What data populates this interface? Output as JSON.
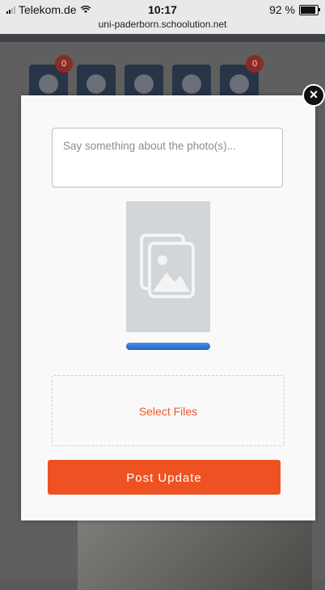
{
  "status_bar": {
    "carrier": "Telekom.de",
    "time": "10:17",
    "battery_percent": "92 %",
    "battery_level": 0.92,
    "url": "uni-paderborn.schoolution.net"
  },
  "background": {
    "tiles": [
      {
        "icon": "clipboard-icon",
        "badge": "0"
      },
      {
        "icon": "map-pin-icon",
        "badge": ""
      },
      {
        "icon": "runner-icon",
        "badge": ""
      },
      {
        "icon": "smiley-icon",
        "badge": ""
      },
      {
        "icon": "share-icon",
        "badge": "0"
      }
    ]
  },
  "modal": {
    "close_icon": "close-icon",
    "caption_placeholder": "Say something about the photo(s)...",
    "preview_icon": "images-icon",
    "upload_progress": 1.0,
    "select_files_label": "Select Files",
    "post_button_label": "Post Update"
  },
  "colors": {
    "accent": "#ee5223",
    "progress": "#2f77d6",
    "tile_bg": "#283447",
    "badge": "#8a2b25"
  }
}
